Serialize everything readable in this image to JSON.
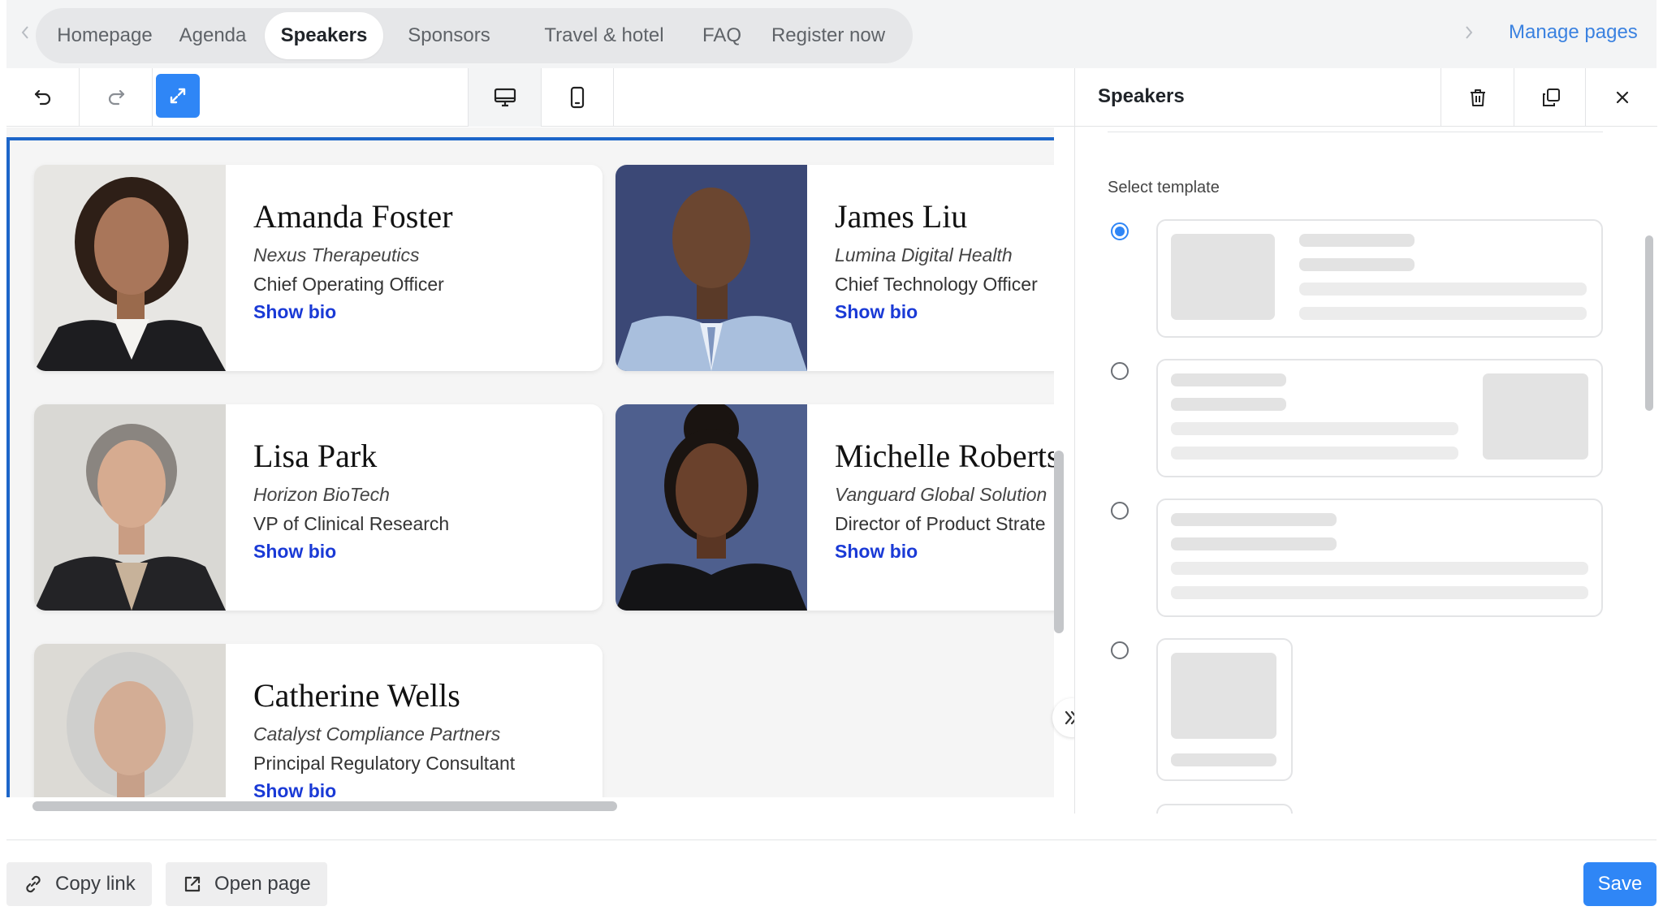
{
  "nav": {
    "tabs": [
      {
        "label": "Homepage"
      },
      {
        "label": "Agenda"
      },
      {
        "label": "Speakers",
        "active": true
      },
      {
        "label": "Sponsors"
      },
      {
        "label": "Travel & hotel"
      },
      {
        "label": "FAQ"
      },
      {
        "label": "Register now"
      }
    ],
    "manage_pages": "Manage pages"
  },
  "toolbar": {
    "icons": [
      "undo-icon",
      "redo-icon",
      "expand-icon",
      "desktop-icon",
      "mobile-icon"
    ],
    "active_device": "desktop"
  },
  "speakers": [
    {
      "name": "Amanda Foster",
      "company": "Nexus Therapeutics",
      "role": "Chief Operating Officer",
      "bio_link": "Show bio"
    },
    {
      "name": "James Liu",
      "company": "Lumina Digital Health",
      "role": "Chief Technology Officer",
      "bio_link": "Show bio"
    },
    {
      "name": "Lisa Park",
      "company": "Horizon BioTech",
      "role": "VP of Clinical Research",
      "bio_link": "Show bio"
    },
    {
      "name": "Michelle Roberts",
      "company": "Vanguard Global Solution",
      "role": "Director of Product Strate",
      "bio_link": "Show bio"
    },
    {
      "name": "Catherine Wells",
      "company": "Catalyst Compliance Partners",
      "role": "Principal Regulatory Consultant",
      "bio_link": "Show bio"
    }
  ],
  "panel": {
    "title": "Speakers",
    "select_template_label": "Select template",
    "selected_template": 1,
    "icons": [
      "trash-icon",
      "duplicate-icon",
      "close-icon"
    ]
  },
  "footer": {
    "copy_link": "Copy link",
    "open_page": "Open page",
    "save": "Save"
  },
  "colors": {
    "accent": "#2f86f6",
    "link": "#1a3ad6",
    "selection": "#1d66c9"
  }
}
